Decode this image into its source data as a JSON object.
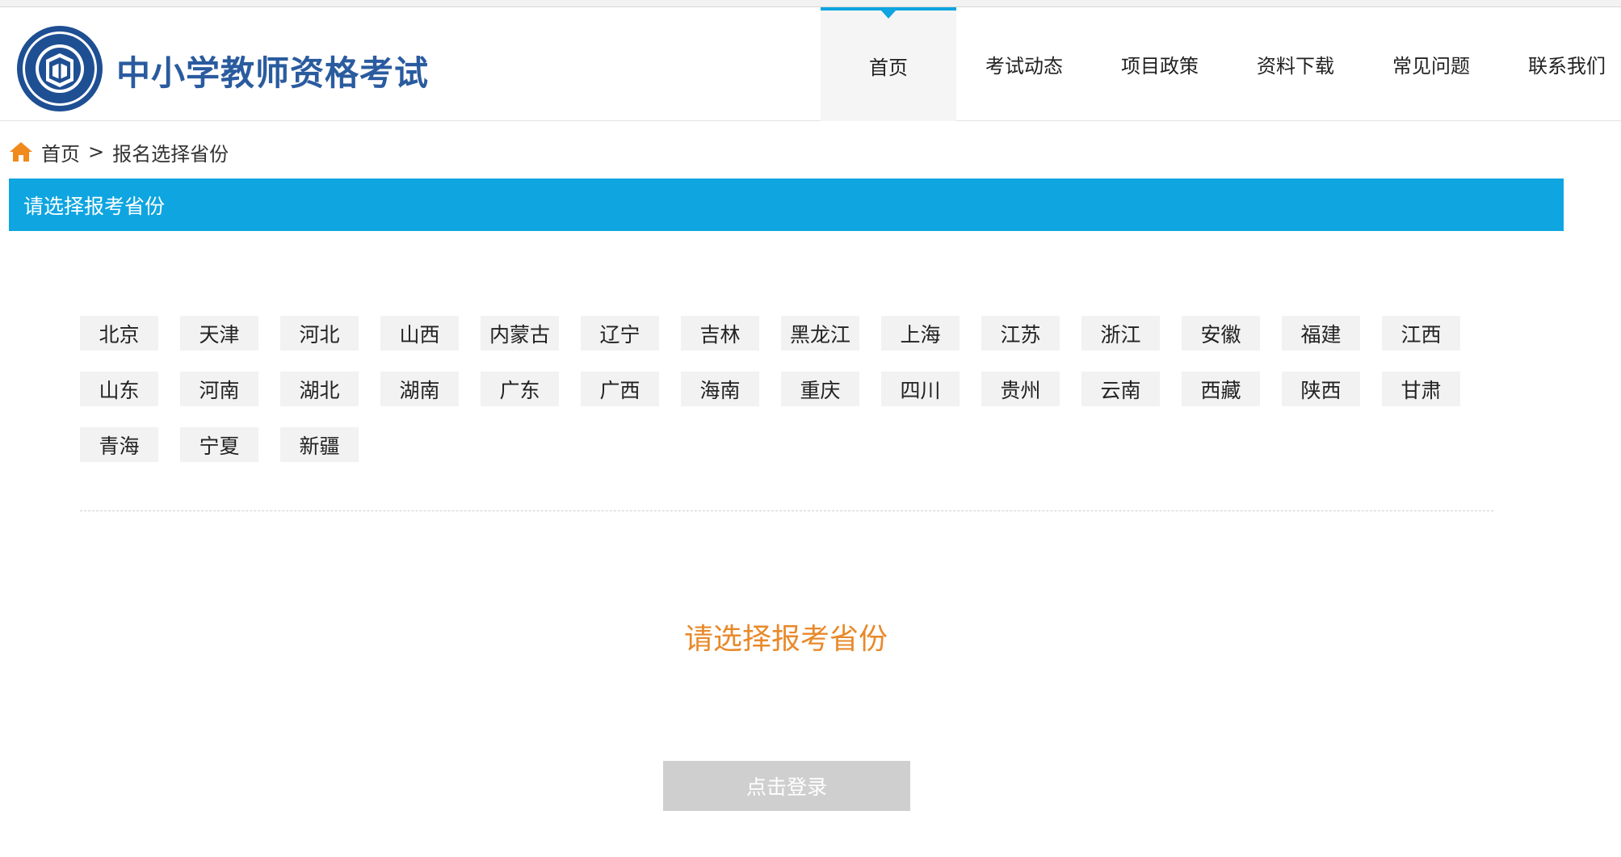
{
  "header": {
    "site_title": "中小学教师资格考试",
    "nav": [
      {
        "label": "首页",
        "active": true
      },
      {
        "label": "考试动态",
        "active": false
      },
      {
        "label": "项目政策",
        "active": false
      },
      {
        "label": "资料下载",
        "active": false
      },
      {
        "label": "常见问题",
        "active": false
      },
      {
        "label": "联系我们",
        "active": false
      }
    ]
  },
  "breadcrumb": {
    "home": "首页",
    "separator": ">",
    "current": "报名选择省份"
  },
  "section": {
    "title": "请选择报考省份"
  },
  "provinces": [
    "北京",
    "天津",
    "河北",
    "山西",
    "内蒙古",
    "辽宁",
    "吉林",
    "黑龙江",
    "上海",
    "江苏",
    "浙江",
    "安徽",
    "福建",
    "江西",
    "山东",
    "河南",
    "湖北",
    "湖南",
    "广东",
    "广西",
    "海南",
    "重庆",
    "四川",
    "贵州",
    "云南",
    "西藏",
    "陕西",
    "甘肃",
    "青海",
    "宁夏",
    "新疆"
  ],
  "prompt": "请选择报考省份",
  "login_button": "点击登录",
  "colors": {
    "accent_blue": "#0ea5e0",
    "title_blue": "#2a5b9f",
    "prompt_orange": "#e8892a",
    "home_icon_orange": "#f08a1c",
    "disabled_gray": "#cfcfcf"
  }
}
